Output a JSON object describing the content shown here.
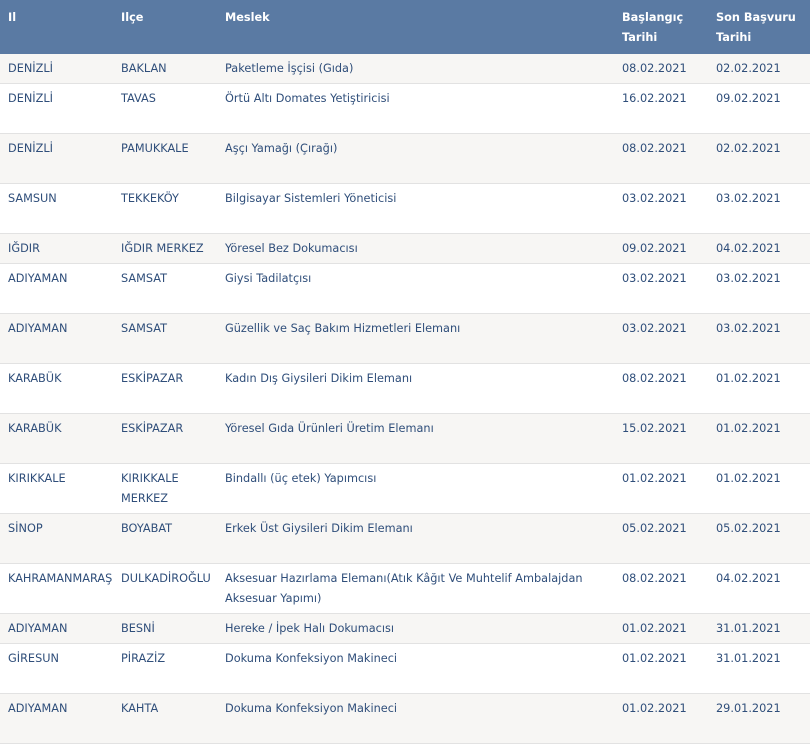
{
  "headers": {
    "il": "Il",
    "ilce": "Ilçe",
    "meslek": "Meslek",
    "baslangic": "Başlangıç Tarihi",
    "son_basvuru": "Son Başvuru Tarihi"
  },
  "rows": [
    {
      "il": "DENİZLİ",
      "ilce": "BAKLAN",
      "meslek": "Paketleme İşçisi (Gıda)",
      "baslangic": "08.02.2021",
      "son_basvuru": "02.02.2021"
    },
    {
      "il": "DENİZLİ",
      "ilce": "TAVAS",
      "meslek": "Örtü Altı Domates Yetiştiricisi",
      "baslangic": "16.02.2021",
      "son_basvuru": "09.02.2021"
    },
    {
      "il": "DENİZLİ",
      "ilce": "PAMUKKALE",
      "meslek": "Aşçı Yamağı (Çırağı)",
      "baslangic": "08.02.2021",
      "son_basvuru": "02.02.2021"
    },
    {
      "il": "SAMSUN",
      "ilce": "TEKKEKÖY",
      "meslek": "Bilgisayar Sistemleri Yöneticisi",
      "baslangic": "03.02.2021",
      "son_basvuru": "03.02.2021"
    },
    {
      "il": "IĞDIR",
      "ilce": "IĞDIR MERKEZ",
      "meslek": "Yöresel Bez Dokumacısı",
      "baslangic": "09.02.2021",
      "son_basvuru": "04.02.2021"
    },
    {
      "il": "ADIYAMAN",
      "ilce": "SAMSAT",
      "meslek": "Giysi Tadilatçısı",
      "baslangic": "03.02.2021",
      "son_basvuru": "03.02.2021"
    },
    {
      "il": "ADIYAMAN",
      "ilce": "SAMSAT",
      "meslek": "Güzellik ve Saç Bakım Hizmetleri Elemanı",
      "baslangic": "03.02.2021",
      "son_basvuru": "03.02.2021"
    },
    {
      "il": "KARABÜK",
      "ilce": "ESKİPAZAR",
      "meslek": "Kadın Dış Giysileri Dikim Elemanı",
      "baslangic": "08.02.2021",
      "son_basvuru": "01.02.2021"
    },
    {
      "il": "KARABÜK",
      "ilce": "ESKİPAZAR",
      "meslek": "Yöresel Gıda Ürünleri Üretim Elemanı",
      "baslangic": "15.02.2021",
      "son_basvuru": "01.02.2021"
    },
    {
      "il": "KIRIKKALE",
      "ilce": "KIRIKKALE MERKEZ",
      "meslek": "Bindallı (üç etek) Yapımcısı",
      "baslangic": "01.02.2021",
      "son_basvuru": "01.02.2021"
    },
    {
      "il": "SİNOP",
      "ilce": "BOYABAT",
      "meslek": "Erkek Üst Giysileri Dikim Elemanı",
      "baslangic": "05.02.2021",
      "son_basvuru": "05.02.2021"
    },
    {
      "il": "KAHRAMANMARAŞ",
      "ilce": "DULKADİROĞLU",
      "meslek": "Aksesuar Hazırlama Elemanı(Atık Kâğıt Ve Muhtelif Ambalajdan Aksesuar Yapımı)",
      "baslangic": "08.02.2021",
      "son_basvuru": "04.02.2021"
    },
    {
      "il": "ADIYAMAN",
      "ilce": "BESNİ",
      "meslek": "Hereke / İpek Halı Dokumacısı",
      "baslangic": "01.02.2021",
      "son_basvuru": "31.01.2021"
    },
    {
      "il": "GİRESUN",
      "ilce": "PİRAZİZ",
      "meslek": "Dokuma Konfeksiyon Makineci",
      "baslangic": "01.02.2021",
      "son_basvuru": "31.01.2021"
    },
    {
      "il": "ADIYAMAN",
      "ilce": "KAHTA",
      "meslek": "Dokuma Konfeksiyon Makineci",
      "baslangic": "01.02.2021",
      "son_basvuru": "29.01.2021"
    }
  ]
}
